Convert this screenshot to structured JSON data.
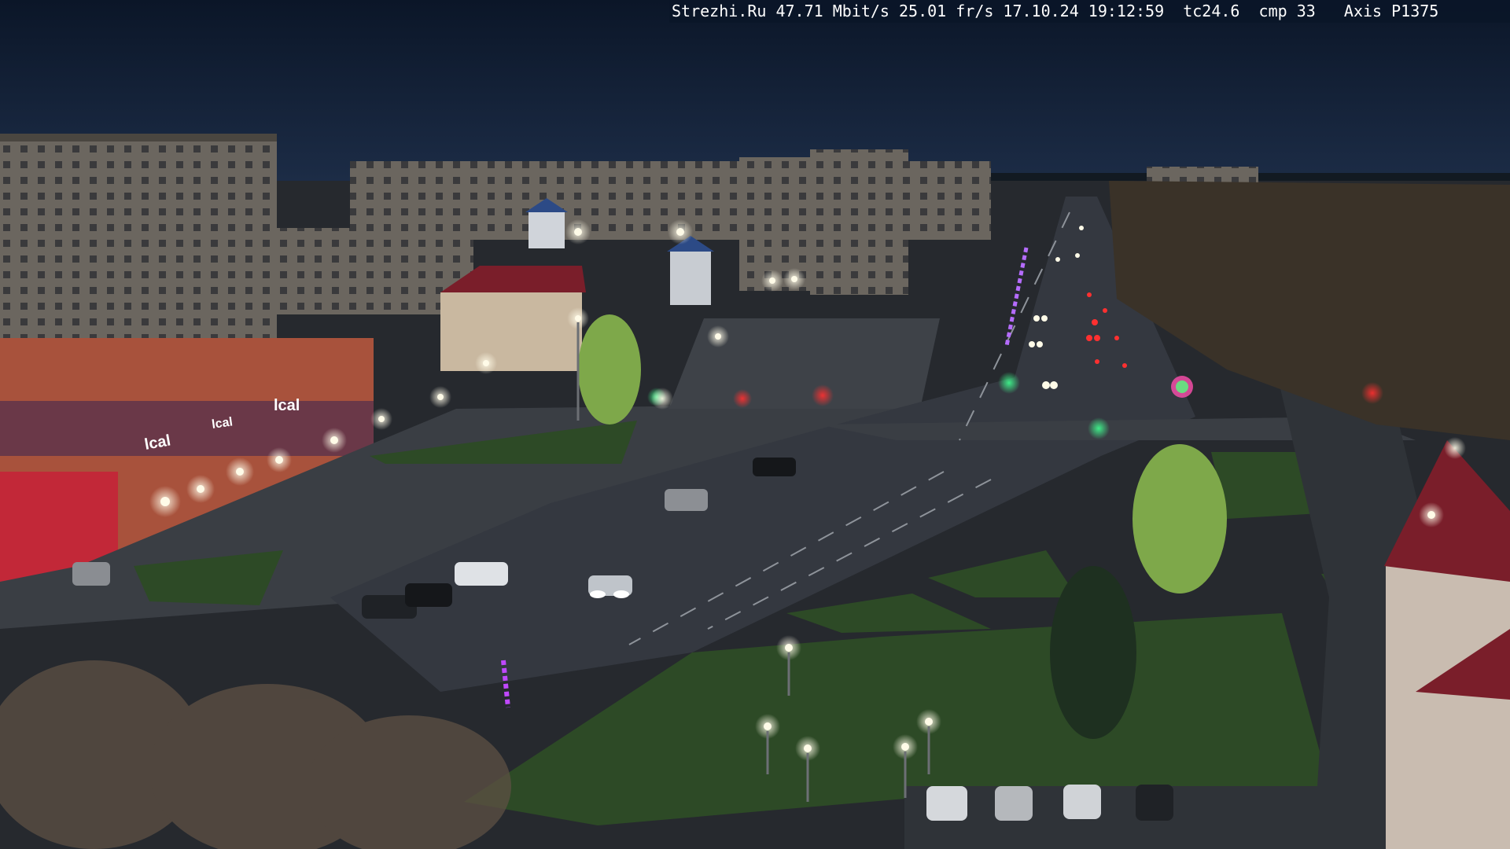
{
  "overlay": {
    "text": "Strezhi.Ru 47.71 Mbit/s 25.01 fr/s 17.10.24 19:12:59  tc24.6  cmp 33   Axis P1375"
  },
  "scene": {
    "type": "night street webcam view",
    "elements": [
      "apartment-blocks",
      "shopping-center",
      "wide-avenue",
      "intersection",
      "parked-cars",
      "moving-cars",
      "street-lamps",
      "trees",
      "lawns",
      "plaza"
    ]
  },
  "shop_signs": [
    "lcal",
    "lcal",
    "lcal"
  ],
  "colors": {
    "sky": "#0e1c33",
    "road": "#343840",
    "plaza": "#3a3e44",
    "grass": "#2d4a26",
    "lamp": "#fffbe8",
    "building": "#5a554f",
    "shop": "#a8523c",
    "roof": "#7a1e2a"
  }
}
